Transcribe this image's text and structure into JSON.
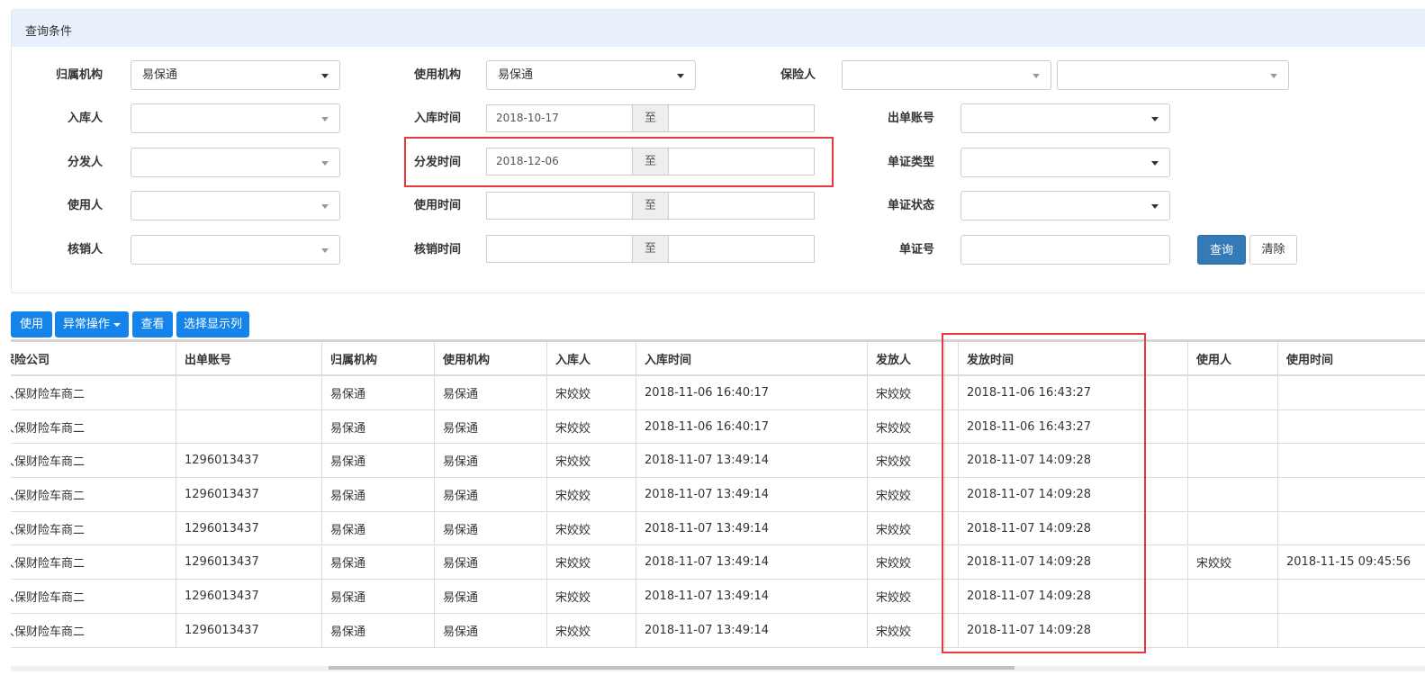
{
  "panel": {
    "title": "查询条件"
  },
  "form": {
    "owner_org": {
      "label": "归属机构",
      "value": "易保通"
    },
    "use_org": {
      "label": "使用机构",
      "value": "易保通"
    },
    "insurer": {
      "label": "保险人",
      "value1": "",
      "value2": ""
    },
    "stock_person": {
      "label": "入库人",
      "value": ""
    },
    "stock_time": {
      "label": "入库时间",
      "from": "2018-10-17",
      "to_label": "至",
      "to": ""
    },
    "issue_account": {
      "label": "出单账号",
      "value": ""
    },
    "distributor": {
      "label": "分发人",
      "value": ""
    },
    "distribute_time": {
      "label": "分发时间",
      "from": "2018-12-06",
      "to_label": "至",
      "to": ""
    },
    "doc_type": {
      "label": "单证类型",
      "value": ""
    },
    "user": {
      "label": "使用人",
      "value": ""
    },
    "use_time": {
      "label": "使用时间",
      "from": "",
      "to_label": "至",
      "to": ""
    },
    "doc_status": {
      "label": "单证状态",
      "value": ""
    },
    "verifier": {
      "label": "核销人",
      "value": ""
    },
    "verify_time": {
      "label": "核销时间",
      "from": "",
      "to_label": "至",
      "to": ""
    },
    "doc_no": {
      "label": "单证号",
      "value": ""
    },
    "query_label": "查询",
    "clear_label": "清除"
  },
  "toolbar": {
    "use": "使用",
    "abnormal": "异常操作",
    "view": "查看",
    "columns": "选择显示列"
  },
  "colors": {
    "primary": "#1484ea",
    "query": "#337ab7",
    "highlight": "#e8383d",
    "panel_header": "#e8f1fb"
  },
  "table": {
    "headers": [
      "保险公司",
      "出单账号",
      "归属机构",
      "使用机构",
      "入库人",
      "入库时间",
      "发放人",
      "",
      "发放时间",
      "使用人",
      "使用时间"
    ],
    "rows": [
      [
        "人保财险车商二",
        "",
        "易保通",
        "易保通",
        "宋姣姣",
        "2018-11-06 16:40:17",
        "宋姣姣",
        "",
        "2018-11-06 16:43:27",
        "",
        ""
      ],
      [
        "人保财险车商二",
        "",
        "易保通",
        "易保通",
        "宋姣姣",
        "2018-11-06 16:40:17",
        "宋姣姣",
        "",
        "2018-11-06 16:43:27",
        "",
        ""
      ],
      [
        "人保财险车商二",
        "1296013437",
        "易保通",
        "易保通",
        "宋姣姣",
        "2018-11-07 13:49:14",
        "宋姣姣",
        "",
        "2018-11-07 14:09:28",
        "",
        ""
      ],
      [
        "人保财险车商二",
        "1296013437",
        "易保通",
        "易保通",
        "宋姣姣",
        "2018-11-07 13:49:14",
        "宋姣姣",
        "",
        "2018-11-07 14:09:28",
        "",
        ""
      ],
      [
        "人保财险车商二",
        "1296013437",
        "易保通",
        "易保通",
        "宋姣姣",
        "2018-11-07 13:49:14",
        "宋姣姣",
        "",
        "2018-11-07 14:09:28",
        "",
        ""
      ],
      [
        "人保财险车商二",
        "1296013437",
        "易保通",
        "易保通",
        "宋姣姣",
        "2018-11-07 13:49:14",
        "宋姣姣",
        "",
        "2018-11-07 14:09:28",
        "宋姣姣",
        "2018-11-15 09:45:56"
      ],
      [
        "人保财险车商二",
        "1296013437",
        "易保通",
        "易保通",
        "宋姣姣",
        "2018-11-07 13:49:14",
        "宋姣姣",
        "",
        "2018-11-07 14:09:28",
        "",
        ""
      ],
      [
        "人保财险车商二",
        "1296013437",
        "易保通",
        "易保通",
        "宋姣姣",
        "2018-11-07 13:49:14",
        "宋姣姣",
        "",
        "2018-11-07 14:09:28",
        "",
        ""
      ]
    ]
  }
}
